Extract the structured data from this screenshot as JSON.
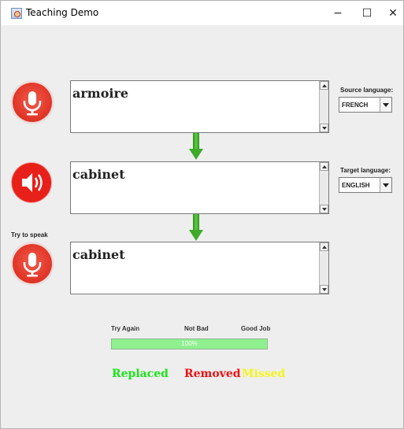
{
  "window": {
    "title": "Teaching Demo",
    "minimize": "−",
    "maximize": "☐",
    "close": "✕"
  },
  "source": {
    "label": "Source language:",
    "value": "FRENCH",
    "text": "armoire"
  },
  "target": {
    "label": "Target language:",
    "value": "ENGLISH",
    "text": "cabinet"
  },
  "speech": {
    "prompt": "Try to speak",
    "text": "cabinet"
  },
  "score": {
    "levels": [
      "Try Again",
      "Not Bad",
      "Good Job"
    ],
    "progress_label": "100%",
    "progress_value": 1.0
  },
  "legend": [
    {
      "label": "Replaced",
      "color": "#19e619"
    },
    {
      "label": "Removed",
      "color": "#ee1111"
    },
    {
      "label": "Missed",
      "color": "#f5f51a"
    }
  ],
  "icons": {
    "app": "java-app-icon",
    "mic": "microphone-icon",
    "speaker": "speaker-icon",
    "arrow": "down-arrow-icon"
  },
  "colors": {
    "arrow_green": "#3daa2a",
    "progress_fill": "#8ff08f",
    "mic_red": "#e2382a",
    "speaker_red": "#e8201a"
  }
}
